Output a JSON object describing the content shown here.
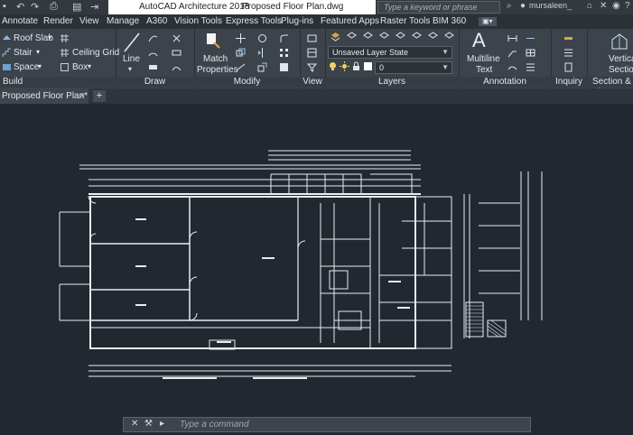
{
  "titlebar": {
    "app_title": "AutoCAD Architecture 2018",
    "file_title": "Proposed Floor Plan.dwg",
    "search_placeholder": "Type a keyword or phrase",
    "user": "mursaleen_"
  },
  "menu": {
    "tabs": [
      "Annotate",
      "Render",
      "View",
      "Manage",
      "A360",
      "Vision Tools",
      "Express Tools",
      "Plug-ins",
      "Featured Apps",
      "Raster Tools",
      "BIM 360"
    ]
  },
  "ribbon": {
    "build": {
      "label": "Build",
      "items": [
        "Roof Slab",
        "Stair",
        "Space",
        "Ceiling Grid",
        "Box"
      ]
    },
    "draw": {
      "label": "Draw",
      "line": "Line"
    },
    "modify": {
      "label": "Modify",
      "match_line1": "Match",
      "match_line2": "Properties"
    },
    "view": {
      "label": "View"
    },
    "layers": {
      "label": "Layers",
      "layer_state": "Unsaved Layer State",
      "current_layer": "0"
    },
    "annotation": {
      "label": "Annotation",
      "multiline_line1": "Multiline",
      "multiline_line2": "Text"
    },
    "inquiry": {
      "label": "Inquiry"
    },
    "section": {
      "label": "Section & El",
      "vertical_line1": "Vertical",
      "vertical_line2": "Section"
    }
  },
  "doc_tabs": {
    "active": "Proposed Floor Plan*",
    "new_tab": "+"
  },
  "command": {
    "placeholder": "Type a command"
  },
  "colors": {
    "canvas": "#212830",
    "ribbon": "#3c434b",
    "linework": "#e8ecef",
    "layer_bulb": "#f4d35e"
  }
}
